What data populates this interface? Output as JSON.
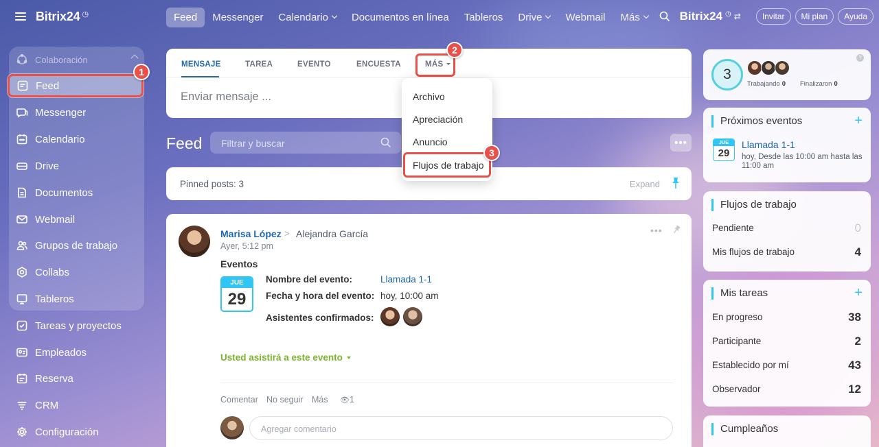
{
  "brand": {
    "name": "Bitrix24",
    "clock": "◷"
  },
  "sidebar": {
    "group_label": "Colaboración",
    "items": [
      {
        "label": "Feed",
        "icon": "feed-icon"
      },
      {
        "label": "Messenger",
        "icon": "chat-icon"
      },
      {
        "label": "Calendario",
        "icon": "calendar-icon"
      },
      {
        "label": "Drive",
        "icon": "drive-icon"
      },
      {
        "label": "Documentos",
        "icon": "document-icon"
      },
      {
        "label": "Webmail",
        "icon": "mail-icon"
      },
      {
        "label": "Grupos de trabajo",
        "icon": "group-icon"
      },
      {
        "label": "Collabs",
        "icon": "collab-icon"
      },
      {
        "label": "Tableros",
        "icon": "board-icon"
      },
      {
        "label": "Tareas y proyectos",
        "icon": "tasks-icon"
      },
      {
        "label": "Empleados",
        "icon": "employees-icon"
      },
      {
        "label": "Reserva",
        "icon": "booking-icon"
      },
      {
        "label": "CRM",
        "icon": "crm-icon"
      },
      {
        "label": "Configuración",
        "icon": "gear-icon"
      }
    ]
  },
  "topnav": {
    "items": [
      {
        "label": "Feed"
      },
      {
        "label": "Messenger"
      },
      {
        "label": "Calendario"
      },
      {
        "label": "Documentos en línea"
      },
      {
        "label": "Tableros"
      },
      {
        "label": "Drive"
      },
      {
        "label": "Webmail"
      },
      {
        "label": "Más"
      }
    ],
    "brand": "Bitrix24",
    "invite": "Invitar",
    "plan": "Mi plan",
    "help": "Ayuda"
  },
  "composer": {
    "tabs": [
      "MENSAJE",
      "TAREA",
      "EVENTO",
      "ENCUESTA",
      "MÁS"
    ],
    "placeholder": "Enviar mensaje ..."
  },
  "dropdown": {
    "items": [
      "Archivo",
      "Apreciación",
      "Anuncio",
      "Flujos de trabajo"
    ]
  },
  "badges": [
    "1",
    "2",
    "3"
  ],
  "feed": {
    "title": "Feed",
    "filter_placeholder": "Filtrar y buscar",
    "more": "•••",
    "pinned_label": "Pinned posts: 3",
    "expand": "Expand"
  },
  "post": {
    "author": "Marisa López",
    "arrow": ">",
    "recipient": "Alejandra García",
    "time": "Ayer, 5:12 pm",
    "dots": "•••",
    "section": "Eventos",
    "cal_month": "JUE",
    "cal_day": "29",
    "event_name_label": "Nombre del evento:",
    "event_name": "Llamada 1-1",
    "event_time_label": "Fecha y hora del evento:",
    "event_time": "hoy, 10:00 am",
    "attendees_label": "Asistentes confirmados:",
    "attend_status": "Usted asistirá a este evento",
    "actions": [
      "Comentar",
      "No seguir",
      "Más"
    ],
    "views": "1",
    "comment_placeholder": "Agregar comentario"
  },
  "widgets": {
    "presence": {
      "count": "3",
      "working_label": "Trabajando",
      "working": "0",
      "finished_label": "Finalizaron",
      "finished": "0"
    },
    "events": {
      "title": "Próximos eventos",
      "cal_month": "JUE",
      "cal_day": "29",
      "name": "Llamada 1-1",
      "desc": "hoy, Desde las 10:00 am hasta las 11:00 am"
    },
    "flows": {
      "title": "Flujos de trabajo",
      "rows": [
        {
          "label": "Pendiente",
          "value": "0"
        },
        {
          "label": "Mis flujos de trabajo",
          "value": "4"
        }
      ]
    },
    "tasks": {
      "title": "Mis tareas",
      "rows": [
        {
          "label": "En progreso",
          "value": "38"
        },
        {
          "label": "Participante",
          "value": "2"
        },
        {
          "label": "Establecido por mí",
          "value": "43"
        },
        {
          "label": "Observador",
          "value": "12"
        }
      ]
    },
    "birthdays": {
      "title": "Cumpleaños"
    }
  },
  "colors": {
    "accent": "#2067b0",
    "highlight": "#e8514a",
    "cyan": "#2fc6f6",
    "green": "#7cb32f"
  }
}
